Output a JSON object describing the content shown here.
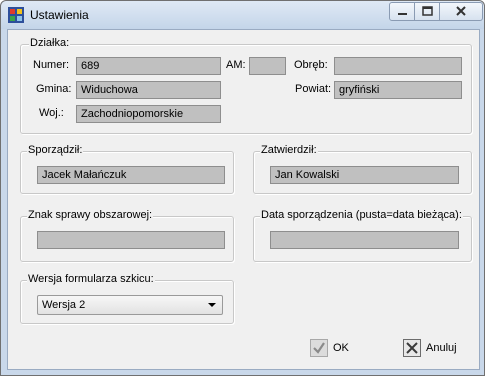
{
  "window": {
    "title": "Ustawienia"
  },
  "colors": {
    "field_bg": "#c0c0c0",
    "client_bg": "#f0f0f0",
    "title_grad_top": "#dfe9f5"
  },
  "dzialka": {
    "legend": "Działka:",
    "numer_label": "Numer:",
    "numer_value": "689",
    "am_label": "AM:",
    "am_value": "",
    "obreb_label": "Obręb:",
    "obreb_value": "",
    "gmina_label": "Gmina:",
    "gmina_value": "Widuchowa",
    "powiat_label": "Powiat:",
    "powiat_value": "gryfiński",
    "woj_label": "Woj.:",
    "woj_value": "Zachodniopomorskie"
  },
  "sporzadzil": {
    "legend": "Sporządził:",
    "value": "Jacek Małańczuk"
  },
  "zatwierdzil": {
    "legend": "Zatwierdził:",
    "value": "Jan Kowalski"
  },
  "znak": {
    "legend": "Znak sprawy obszarowej:",
    "value": ""
  },
  "data": {
    "legend": "Data sporządzenia (pusta=data bieżąca):",
    "value": ""
  },
  "wersja": {
    "legend": "Wersja formularza szkicu:",
    "selected": "Wersja 2"
  },
  "buttons": {
    "ok": "OK",
    "cancel": "Anuluj"
  },
  "icons": {
    "app": "app-icon",
    "ok": "check-icon",
    "cancel": "close-x-icon"
  }
}
